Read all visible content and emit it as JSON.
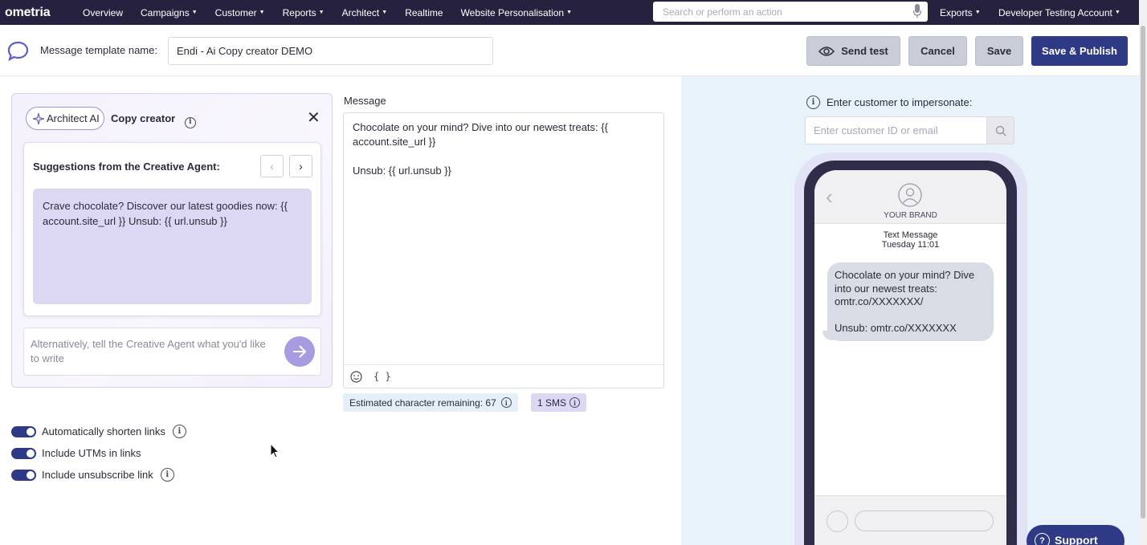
{
  "nav": {
    "logo": "ometria",
    "items": [
      {
        "label": "Overview",
        "caret": false
      },
      {
        "label": "Campaigns",
        "caret": true
      },
      {
        "label": "Customer",
        "caret": true
      },
      {
        "label": "Reports",
        "caret": true
      },
      {
        "label": "Architect",
        "caret": true
      },
      {
        "label": "Realtime",
        "caret": false
      },
      {
        "label": "Website Personalisation",
        "caret": true
      }
    ],
    "search_placeholder": "Search or perform an action",
    "exports": "Exports",
    "account": "Developer Testing Account"
  },
  "header": {
    "template_label": "Message template name:",
    "template_name": "Endi - Ai Copy creator DEMO",
    "send_test": "Send test",
    "cancel": "Cancel",
    "save": "Save",
    "save_publish": "Save & Publish"
  },
  "copy_creator": {
    "badge": "Architect AI",
    "title": "Copy creator",
    "suggestions_title": "Suggestions from the Creative Agent:",
    "suggestion": "Crave chocolate? Discover our latest goodies now: {{ account.site_url }} Unsub: {{ url.unsub }}",
    "prompt_placeholder": "Alternatively, tell the Creative Agent what you'd like to write"
  },
  "toggles": [
    {
      "label": "Automatically shorten links",
      "on": true,
      "info": true
    },
    {
      "label": "Include UTMs in links",
      "on": true,
      "info": false
    },
    {
      "label": "Include unsubscribe link",
      "on": true,
      "info": true
    }
  ],
  "message": {
    "label": "Message",
    "body": "Chocolate on your mind? Dive into our newest treats: {{ account.site_url }}\n\nUnsub: {{ url.unsub }}",
    "toolbar_vars": "{ }",
    "chars_remaining": "Estimated character remaining: 67",
    "sms_count": "1 SMS"
  },
  "preview": {
    "impersonate_label": "Enter customer to impersonate:",
    "impersonate_placeholder": "Enter customer ID or email",
    "brand": "YOUR BRAND",
    "meta_line1": "Text Message",
    "meta_line2": "Tuesday 11:01",
    "bubble": "Chocolate on your mind? Dive into our newest treats: omtr.co/XXXXXXX/\n\nUnsub: omtr.co/XXXXXXX"
  },
  "support": "Support",
  "colors": {
    "nav_bg": "#25213f",
    "primary": "#2e3a86",
    "preview_bg": "#e8f2fb",
    "suggestion_bg": "#dcd8f4"
  }
}
